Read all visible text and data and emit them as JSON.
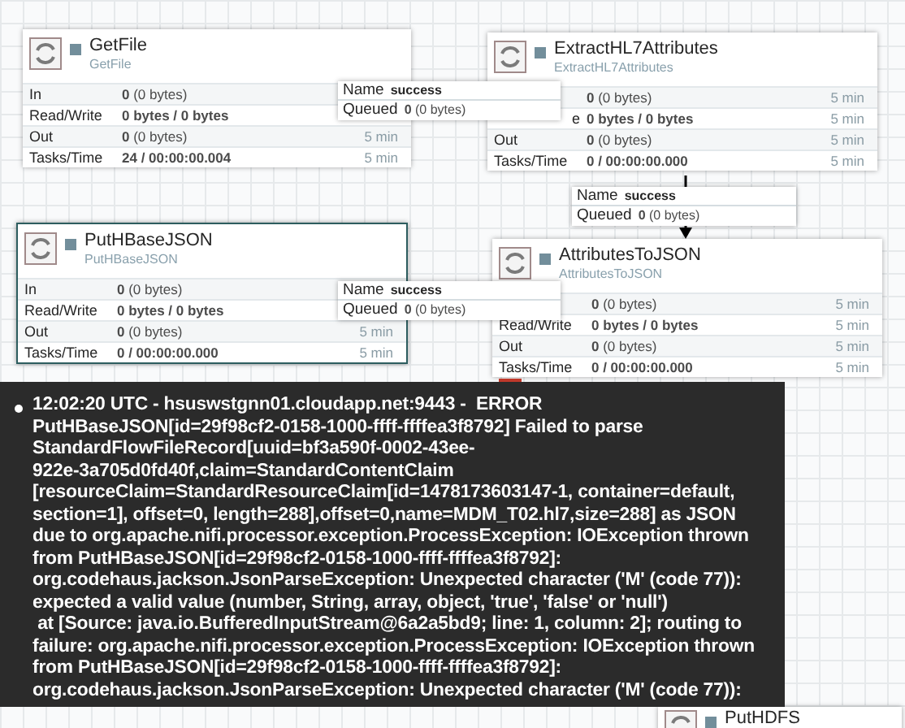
{
  "processors": [
    {
      "name": "GetFile",
      "type": "GetFile",
      "running": false,
      "selected": false,
      "stats": [
        {
          "label": "In",
          "value": "**0** (0 bytes)"
        },
        {
          "label": "Read/Write",
          "value": "**0 bytes / 0 bytes**"
        },
        {
          "label": "Out",
          "value": "**0** (0 bytes)",
          "time": "5 min"
        },
        {
          "label": "Tasks/Time",
          "value": "**24 / 00:00:00.004**",
          "time": "5 min"
        }
      ]
    },
    {
      "name": "ExtractHL7Attributes",
      "type": "ExtractHL7Attributes",
      "running": false,
      "selected": false,
      "stats": [
        {
          "value": "**0** (0 bytes)",
          "time": "5 min"
        },
        {
          "label": "e",
          "value": "**0 bytes / 0 bytes**",
          "time": "5 min"
        },
        {
          "label": "Out",
          "value": "**0** (0 bytes)",
          "time": "5 min"
        },
        {
          "label": "Tasks/Time",
          "value": "**0 / 00:00:00.000**",
          "time": "5 min"
        }
      ]
    },
    {
      "name": "PutHBaseJSON",
      "type": "PutHBaseJSON",
      "running": false,
      "selected": true,
      "stats": [
        {
          "label": "In",
          "value": "**0** (0 bytes)"
        },
        {
          "label": "Read/Write",
          "value": "**0 bytes / 0 bytes**"
        },
        {
          "label": "Out",
          "value": "**0** (0 bytes)",
          "time": "5 min"
        },
        {
          "label": "Tasks/Time",
          "value": "**0 / 00:00:00.000**",
          "time": "5 min"
        }
      ]
    },
    {
      "name": "AttributesToJSON",
      "type": "AttributesToJSON",
      "running": false,
      "selected": false,
      "stats": [
        {
          "value": "**0** (0 bytes)",
          "time": "5 min"
        },
        {
          "label": "Read/Write",
          "value": "**0 bytes / 0 bytes**",
          "time": "5 min"
        },
        {
          "label": "Out",
          "value": "**0** (0 bytes)",
          "time": "5 min"
        },
        {
          "label": "Tasks/Time",
          "value": "**0 / 00:00:00.000**",
          "time": "5 min"
        }
      ]
    },
    {
      "name": "PutHDFS",
      "running": false,
      "selected": false
    }
  ],
  "connections": [
    {
      "name_label": "Name",
      "name": "success",
      "queued_label": "Queued",
      "queued": "**0** (0 bytes)"
    },
    {
      "name_label": "Name",
      "name": "success",
      "queued_label": "Queued",
      "queued": "**0** (0 bytes)"
    },
    {
      "name_label": "Name",
      "name": "success",
      "queued_label": "Queued",
      "queued": "**0** (0 bytes)"
    }
  ],
  "bulletin_tooltip": {
    "bulletins": [
      {
        "text": "12:02:20 UTC - hsuswstgnn01.cloudapp.net:9443 -  ERROR\nPutHBaseJSON[id=29f98cf2-0158-1000-ffff-ffffea3f8792] Failed to parse\nStandardFlowFileRecord[uuid=bf3a590f-0002-43ee-\n922e-3a705d0fd40f,claim=StandardContentClaim\n[resourceClaim=StandardResourceClaim[id=1478173603147-1, container=default,\nsection=1], offset=0, length=288],offset=0,name=MDM_T02.hl7,size=288] as JSON\ndue to org.apache.nifi.processor.exception.ProcessException: IOException thrown\nfrom PutHBaseJSON[id=29f98cf2-0158-1000-ffff-ffffea3f8792]:\norg.codehaus.jackson.JsonParseException: Unexpected character ('M' (code 77)):\nexpected a valid value (number, String, array, object, 'true', 'false' or 'null')\n at [Source: java.io.BufferedInputStream@6a2a5bd9; line: 1, column: 2]; routing to\nfailure: org.apache.nifi.processor.exception.ProcessException: IOException thrown\nfrom PutHBaseJSON[id=29f98cf2-0158-1000-ffff-ffffea3f8792]:\norg.codehaus.jackson.JsonParseException: Unexpected character ('M' (code 77)):"
      }
    ]
  }
}
